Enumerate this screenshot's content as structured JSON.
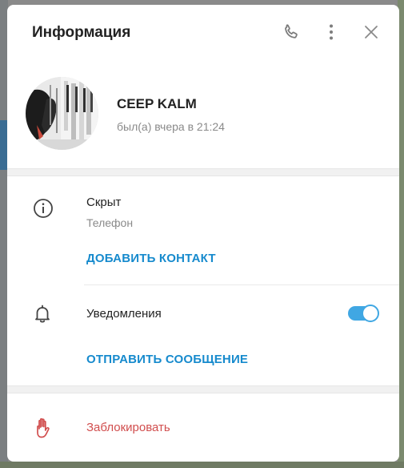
{
  "dialog": {
    "title": "Информация"
  },
  "profile": {
    "name": "CEEP KALM",
    "status": "был(а) вчера в 21:24"
  },
  "phone": {
    "value": "Скрыт",
    "label": "Телефон"
  },
  "actions": {
    "add_contact": "ДОБАВИТЬ КОНТАКТ",
    "send_message": "ОТПРАВИТЬ СООБЩЕНИЕ",
    "block": "Заблокировать"
  },
  "notifications": {
    "label": "Уведомления",
    "enabled": true
  },
  "colors": {
    "accent": "#168acd",
    "toggle": "#40a7e3",
    "danger": "#d14e4e",
    "muted": "#8a8a8a"
  },
  "icons": {
    "call": "phone-icon",
    "menu": "more-vertical-icon",
    "close": "close-icon",
    "info": "info-icon",
    "notifications": "bell-icon",
    "block": "hand-stop-icon"
  }
}
